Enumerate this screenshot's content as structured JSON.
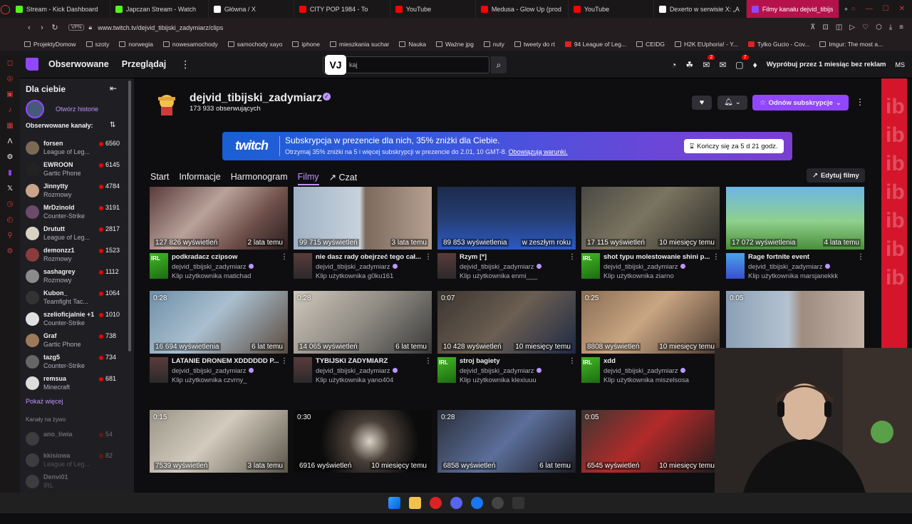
{
  "browser": {
    "tabs": [
      {
        "label": "Stream - Kick Dashboard",
        "color": "#53fc18"
      },
      {
        "label": "Japczan Stream - Watch",
        "color": "#53fc18"
      },
      {
        "label": "Główna / X",
        "color": "#ffffff"
      },
      {
        "label": "CITY POP 1984 - To",
        "color": "#ff0000"
      },
      {
        "label": "YouTube",
        "color": "#ff0000"
      },
      {
        "label": "Medusa - Glow Up (prod",
        "color": "#ff0000"
      },
      {
        "label": "YouTube",
        "color": "#ff0000"
      },
      {
        "label": "Dexerto w serwisie X: „A",
        "color": "#ffffff"
      },
      {
        "label": "Filmy kanału dejvid_tibijs",
        "color": "#9147ff",
        "active": true
      }
    ],
    "new_tab": "+",
    "vpn": "VPN",
    "url": "www.twitch.tv/dejvid_tibijski_zadymiarz/clips",
    "bookmarks": [
      "ProjektyDomow",
      "szoty",
      "norwegia",
      "nowesamochody",
      "samochody xayo",
      "iphone",
      "mieszkania suchar",
      "Nauka",
      "Ważne jpg",
      "nuty",
      "tweety do rt",
      "94 League of Leg...",
      "CEIDG",
      "H2K EUphoria! - Y...",
      "Tylko Gucio - Cov...",
      "Imgur: The most a..."
    ]
  },
  "twitch_nav": {
    "following": "Obserwowane",
    "browse": "Przeglądaj",
    "search_placeholder": "kaj",
    "vj_badge": "VJ",
    "notifications_badge_1": "2",
    "notifications_badge_2": "7",
    "prime_cta": "Wypróbuj przez 1 miesiąc bez reklam",
    "user_initials": "MS"
  },
  "sidebar": {
    "title": "Dla ciebie",
    "history_label": "Otwórz historie",
    "followed_title": "Obserwowane kanały:",
    "channels": [
      {
        "name": "forsen",
        "game": "League of Leg...",
        "viewers": "6560",
        "color": "#7a6a55"
      },
      {
        "name": "EWROON",
        "game": "Gartic Phone",
        "viewers": "6145",
        "color": "#222"
      },
      {
        "name": "Jinnytty",
        "game": "Rozmowy",
        "viewers": "4784",
        "color": "#c9a48a"
      },
      {
        "name": "MrDzinold",
        "game": "Counter-Strike",
        "viewers": "3191",
        "color": "#6b4b6a"
      },
      {
        "name": "Drututt",
        "game": "League of Leg...",
        "viewers": "2817",
        "color": "#d9d2c0"
      },
      {
        "name": "demonzz1",
        "game": "Rozmowy",
        "viewers": "1523",
        "color": "#8a3c3c"
      },
      {
        "name": "sashagrey",
        "game": "Rozmowy",
        "viewers": "1112",
        "color": "#8b8b8b"
      },
      {
        "name": "Kubon_",
        "game": "Teamfight Tac...",
        "viewers": "1064",
        "color": "#333"
      },
      {
        "name": "szelioficjalnie +1",
        "game": "Counter-Strike",
        "viewers": "1010",
        "color": "#e0e0e0"
      },
      {
        "name": "Graf",
        "game": "Gartic Phone",
        "viewers": "738",
        "color": "#9c7a5a"
      },
      {
        "name": "tazg5",
        "game": "Counter-Strike",
        "viewers": "734",
        "color": "#666"
      },
      {
        "name": "remsua",
        "game": "Minecraft",
        "viewers": "681",
        "color": "#ddd"
      }
    ],
    "show_more": "Pokaż więcej",
    "live_title": "Kanały na żywo",
    "live_channels": [
      {
        "name": "ano_liwia",
        "game": "",
        "viewers": "54",
        "color": "#777"
      },
      {
        "name": "kkisiowa",
        "game": "League of Leg...",
        "viewers": "82",
        "color": "#777"
      },
      {
        "name": "Denvi01",
        "game": "IRL",
        "viewers": "",
        "color": "#777"
      }
    ]
  },
  "channel": {
    "name": "dejvid_tibijski_zadymiarz",
    "followers": "173 933 obserwujących",
    "resubscribe": "Odnów subskrypcje"
  },
  "promo": {
    "logo": "twitch",
    "title": "Subskrypcja w prezencie dla nich, 35% zniżki dla Ciebie.",
    "subtitle": "Otrzymaj 35% zniżki na 5 i więcej subskrypcji w prezencie do 2.01, 10 GMT-8.",
    "terms": "Obowiązują warunki.",
    "ends": "Kończy się za 5 d 21 godz."
  },
  "channel_tabs": [
    "Start",
    "Informacje",
    "Harmonogram",
    "Filmy",
    "Czat"
  ],
  "edit_films": "Edytuj filmy",
  "clips": [
    {
      "duration": "",
      "views": "127 826 wyświetleń",
      "age": "2 lata temu",
      "title": "podkradacz czipsow",
      "channel": "dejvid_tibijski_zadymiarz",
      "by": "Klip użytkownika matichad",
      "bg": "linear-gradient(135deg,#5a3b3b,#b9a29a 40%,#6e4f4a 70%,#2a1e1e)",
      "avatar": "irl"
    },
    {
      "duration": "",
      "views": "99 715 wyświetleń",
      "age": "3 lata temu",
      "title": "nie dasz rady obejrzeć tego cał...",
      "channel": "dejvid_tibijski_zadymiarz",
      "by": "Klip użytkownika g0ku161",
      "bg": "linear-gradient(90deg,#9fb2c4 0%,#c8d2dc 48%,#7c6a5e 52%,#b6a090 100%)",
      "avatar": "pic"
    },
    {
      "duration": "",
      "views": "89 853 wyświetlenia",
      "age": "w zeszłym roku",
      "title": "Rzym [*]",
      "channel": "dejvid_tibijski_zadymiarz",
      "by": "Klip użytkownika enmi___",
      "bg": "linear-gradient(180deg,#1b2b4a 0%,#27407a 55%,#2b59c5 100%)",
      "avatar": "pic"
    },
    {
      "duration": "",
      "views": "17 115 wyświetleń",
      "age": "10 miesięcy temu",
      "title": "shot typu molestowanie shini p...",
      "channel": "dejvid_tibijski_zadymiarz",
      "by": "Klip użytkownika ziarno",
      "bg": "linear-gradient(135deg,#4a4a44,#7a7460 45%,#2d2c28)",
      "avatar": "irl"
    },
    {
      "duration": "",
      "views": "17 072 wyświetlenia",
      "age": "4 lata temu",
      "title": "Rage fortnite event",
      "channel": "dejvid_tibijski_zadymiarz",
      "by": "Klip użytkownika marsjanekkk",
      "bg": "linear-gradient(180deg,#6cb6e6 0%,#8fd08c 55%,#4a8e3a 100%)",
      "avatar": "pic2"
    },
    {
      "duration": "0:28",
      "views": "16 694 wyświetlenia",
      "age": "6 lat temu",
      "title": "LATANIE DRONEM XDDDDDD P...",
      "channel": "dejvid_tibijski_zadymiarz",
      "by": "Klip użytkownika czvrny_",
      "bg": "linear-gradient(135deg,#6f8fa8,#a9bfcf 45%,#5b4a3e)",
      "avatar": "pic"
    },
    {
      "duration": "0:28",
      "views": "14 065 wyświetleń",
      "age": "6 lat temu",
      "title": "TYBIJSKI ZADYMIARZ",
      "channel": "dejvid_tibijski_zadymiarz",
      "by": "Klip użytkownika yano404",
      "bg": "linear-gradient(135deg,#cfc8bc,#8e8a82 50%,#3a3a3a)",
      "avatar": "pic"
    },
    {
      "duration": "0:07",
      "views": "10 428 wyświetleń",
      "age": "10 miesięcy temu",
      "title": "stroj bagiety",
      "channel": "dejvid_tibijski_zadymiarz",
      "by": "Klip użytkownika klexiuuu",
      "bg": "linear-gradient(135deg,#3b3530,#6b5e52 50%,#1f2a44)",
      "avatar": "irl"
    },
    {
      "duration": "0:25",
      "views": "8808 wyświetleń",
      "age": "10 miesięcy temu",
      "title": "xdd",
      "channel": "dejvid_tibijski_zadymiarz",
      "by": "Klip użytkownika miszelsosa",
      "bg": "linear-gradient(135deg,#8a6e55,#c9a582 45%,#4a3a30)",
      "avatar": "irl"
    },
    {
      "duration": "0:05",
      "views": "",
      "age": "",
      "title": "",
      "channel": "",
      "by": "",
      "bg": "linear-gradient(90deg,#8aa0b6 0%,#b4c2cf 45%,#9e8c80 55%,#c4b3a6 100%)",
      "avatar": ""
    },
    {
      "duration": "0:15",
      "views": "7539 wyświetleń",
      "age": "3 lata temu",
      "title": "",
      "channel": "",
      "by": "",
      "bg": "linear-gradient(135deg,#9a9488,#d2cbbd 45%,#5a5348)",
      "avatar": ""
    },
    {
      "duration": "0:30",
      "views": "6916 wyświetleń",
      "age": "10 miesięcy temu",
      "title": "",
      "channel": "",
      "by": "",
      "bg": "radial-gradient(circle at 55% 50%,#d9d2c6 0%,#4a3f38 25%,#0b0b0b 60%)",
      "avatar": ""
    },
    {
      "duration": "0:28",
      "views": "6858 wyświetleń",
      "age": "6 lat temu",
      "title": "",
      "channel": "",
      "by": "",
      "bg": "linear-gradient(135deg,#2a2f3a,#5c6f9a 50%,#1c1c24)",
      "avatar": ""
    },
    {
      "duration": "0:05",
      "views": "6545 wyświetleń",
      "age": "10 miesięcy temu",
      "title": "",
      "channel": "",
      "by": "",
      "bg": "linear-gradient(135deg,#3d3632,#b22a2a 45%,#1c1c1c)",
      "avatar": ""
    }
  ],
  "right_panel_text": "ib\nib\nib\nib\nib\nib\nib",
  "colors": {
    "accent": "#9147ff",
    "accent_light": "#bf94ff",
    "live": "#eb0400",
    "bg": "#0e0e10"
  }
}
